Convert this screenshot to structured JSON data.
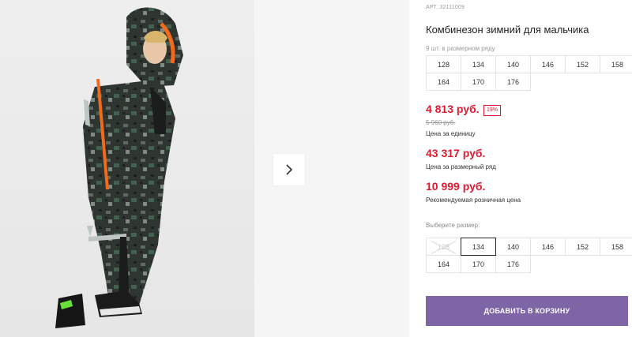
{
  "product": {
    "sku": "АРТ. 32111009",
    "title": "Комбинезон зимний для мальчика"
  },
  "pack": {
    "note": "9 шт. в размерном ряду",
    "sizes": [
      "128",
      "134",
      "140",
      "146",
      "152",
      "158",
      "164",
      "170",
      "176"
    ]
  },
  "prices": {
    "unit_price": "4 813 руб.",
    "discount_badge": "19%",
    "old_price": "5 960 руб.",
    "unit_caption": "Цена за единицу",
    "pack_price": "43 317 руб.",
    "pack_caption": "Цена за размерный ряд",
    "retail_price": "10 999 руб.",
    "retail_caption": "Рекомендуемая розничная цена"
  },
  "size_select": {
    "label": "Выберите размер:",
    "sizes": [
      "128",
      "134",
      "140",
      "146",
      "152",
      "158",
      "164",
      "170",
      "176"
    ],
    "selected": "134",
    "unavailable": [
      "128"
    ]
  },
  "cart": {
    "button_label": "ДОБАВИТЬ В КОРЗИНУ"
  },
  "gallery": {
    "next_icon": "chevron-right-icon"
  },
  "colors": {
    "price_red": "#e21a31",
    "button_purple": "#7d65a6"
  }
}
